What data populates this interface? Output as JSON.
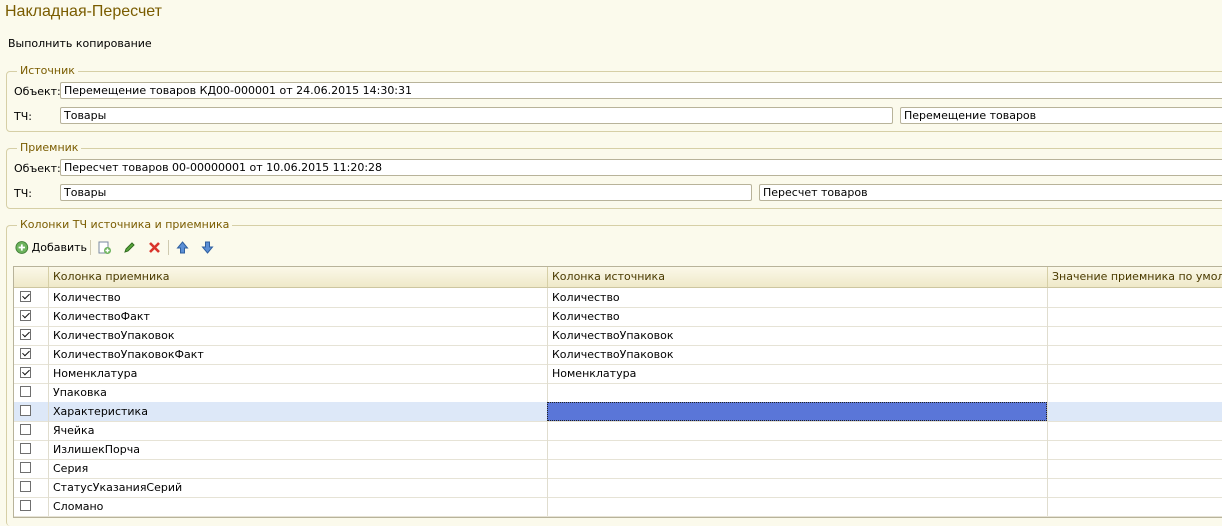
{
  "window": {
    "title": "Накладная-Пересчет"
  },
  "commands": {
    "execute_copy": "Выполнить копирование"
  },
  "source": {
    "group_title": "Источник",
    "object_label": "Объект:",
    "object_value": "Перемещение товаров КД00-000001 от 24.06.2015 14:30:31",
    "tab_label": "ТЧ:",
    "tab_value": "Товары",
    "tab_presentation": "Перемещение товаров"
  },
  "receiver": {
    "group_title": "Приемник",
    "object_label": "Объект:",
    "object_value": "Пересчет товаров 00-00000001 от 10.06.2015 11:20:28",
    "tab_label": "ТЧ:",
    "tab_value": "Товары",
    "tab_presentation": "Пересчет товаров"
  },
  "columns_group": {
    "title": "Колонки ТЧ источника и приемника",
    "toolbar": {
      "add_label": "Добавить",
      "icons": [
        "add-icon",
        "copy-icon",
        "edit-icon",
        "delete-icon",
        "move-up-icon",
        "move-down-icon"
      ]
    },
    "headers": [
      "Колонка приемника",
      "Колонка источника",
      "Значение приемника по умолчанию"
    ],
    "rows": [
      {
        "checked": true,
        "receiver": "Количество",
        "source": "Количество",
        "default": ""
      },
      {
        "checked": true,
        "receiver": "КоличествоФакт",
        "source": "Количество",
        "default": ""
      },
      {
        "checked": true,
        "receiver": "КоличествоУпаковок",
        "source": "КоличествоУпаковок",
        "default": ""
      },
      {
        "checked": true,
        "receiver": "КоличествоУпаковокФакт",
        "source": "КоличествоУпаковок",
        "default": ""
      },
      {
        "checked": true,
        "receiver": "Номенклатура",
        "source": "Номенклатура",
        "default": ""
      },
      {
        "checked": false,
        "receiver": "Упаковка",
        "source": "",
        "default": ""
      },
      {
        "checked": false,
        "receiver": "Характеристика",
        "source": "",
        "default": "",
        "selected": true
      },
      {
        "checked": false,
        "receiver": "Ячейка",
        "source": "",
        "default": ""
      },
      {
        "checked": false,
        "receiver": "ИзлишекПорча",
        "source": "",
        "default": ""
      },
      {
        "checked": false,
        "receiver": "Серия",
        "source": "",
        "default": ""
      },
      {
        "checked": false,
        "receiver": "СтатусУказанияСерий",
        "source": "",
        "default": ""
      },
      {
        "checked": false,
        "receiver": "Сломано",
        "source": "",
        "default": ""
      }
    ]
  },
  "colors": {
    "title": "#7a5c00",
    "selection": "#5a76d8",
    "row_highlight": "#dde8f8"
  }
}
